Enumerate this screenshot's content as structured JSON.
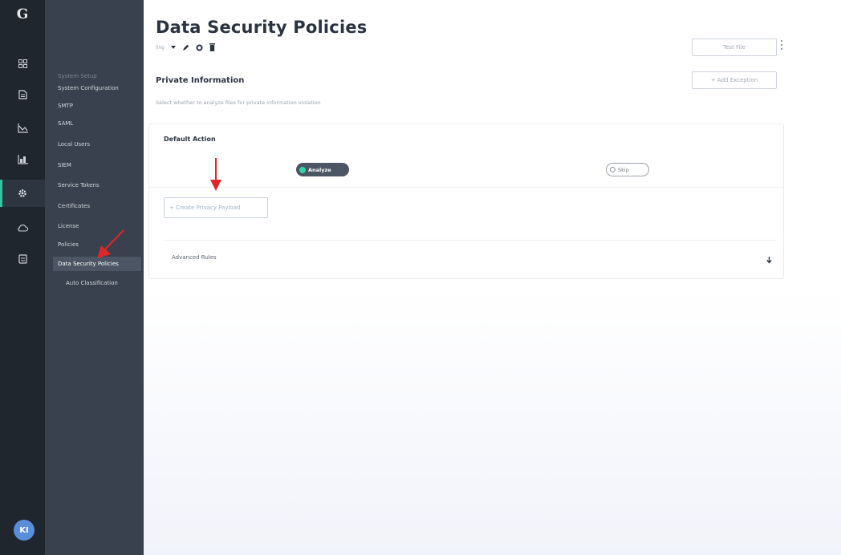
{
  "colors": {
    "rail_bg": "#1f262e",
    "nav_bg": "#38414d",
    "nav_active_bg": "#4b5563",
    "accent": "#33c4a3",
    "toggle_dot": "#34d3a6",
    "annotation_arrow": "#e02626"
  },
  "rail": {
    "logo": "G",
    "icons": [
      "dashboard-icon",
      "document-icon",
      "chart-icon",
      "analytics-icon",
      "settings-icon",
      "cloud-icon",
      "report-icon"
    ],
    "active_icon": "settings-icon",
    "avatar_initials": "KI"
  },
  "subnav": {
    "section_label": "System Setup",
    "items": [
      {
        "label": "System Configuration"
      },
      {
        "label": "SMTP"
      },
      {
        "label": "SAML"
      },
      {
        "label": "Local Users"
      },
      {
        "label": "SIEM"
      },
      {
        "label": "Service Tokens"
      },
      {
        "label": "Certificates"
      },
      {
        "label": "License"
      },
      {
        "label": "Policies"
      },
      {
        "label": "Data Security Policies"
      },
      {
        "label": "Auto Classification"
      }
    ],
    "active_item": "Data Security Policies"
  },
  "header": {
    "title": "Data Security Policies",
    "policy_name": "ling",
    "test_file_label": "Test File"
  },
  "section": {
    "title": "Private Information",
    "description": "Select whether to analyze files for private information violation",
    "add_exception_label": "+ Add Exception"
  },
  "card": {
    "title": "Default Action",
    "analyze_label": "Analyze",
    "skip_label": "Skip",
    "selected": "Analyze",
    "create_payload_label": "+ Create Privacy Payload",
    "advanced_rules_label": "Advanced Rules"
  }
}
